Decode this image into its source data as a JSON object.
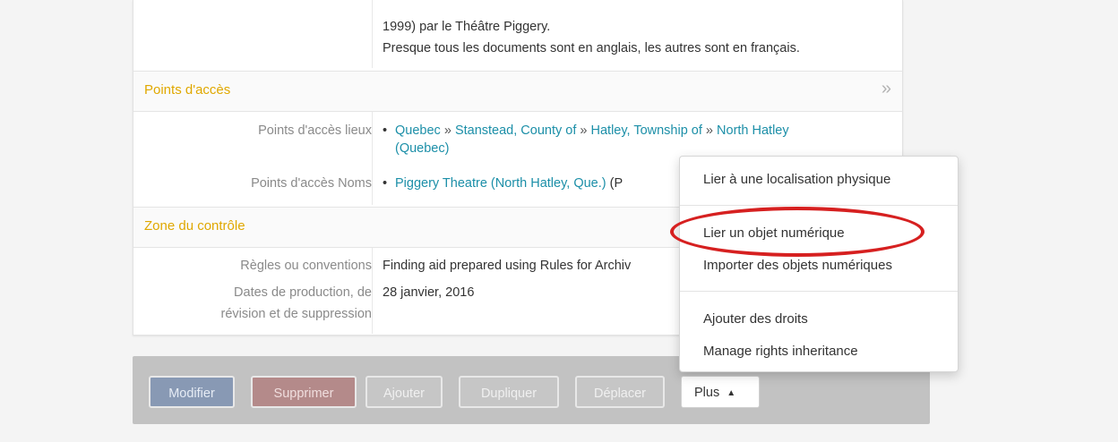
{
  "top": {
    "line1": "1999) par le Théâtre Piggery.",
    "line2": "Presque tous les documents sont en anglais, les autres sont en français."
  },
  "sections": {
    "access": {
      "title": "Points d'accès",
      "toggle": "»"
    },
    "control": {
      "title": "Zone du contrôle"
    }
  },
  "access_fields": {
    "places_label": "Points d'accès lieux",
    "places": [
      "Quebec",
      "Stanstead, County of",
      "Hatley, Township of",
      "North Hatley",
      "(Quebec)"
    ],
    "place_sep": "»",
    "names_label": "Points d'accès Noms",
    "name_link": "Piggery Theatre (North Hatley, Que.)",
    "name_suffix": "(P"
  },
  "control_fields": {
    "rules_label": "Règles ou conventions",
    "rules_value": "Finding aid prepared using Rules for Archiv",
    "dates_label_1": "Dates de production, de",
    "dates_label_2": "révision et de suppression",
    "dates_value": "28 janvier, 2016"
  },
  "actions": {
    "edit": "Modifier",
    "delete": "Supprimer",
    "add": "Ajouter",
    "duplicate": "Dupliquer",
    "move": "Déplacer",
    "more": "Plus",
    "more_icon": "caret-up-icon"
  },
  "menu": {
    "link_physical": "Lier à une localisation physique",
    "link_digital": "Lier un objet numérique",
    "import_digital": "Importer des objets numériques",
    "add_rights": "Ajouter des droits",
    "manage_rights": "Manage rights inheritance"
  },
  "colors": {
    "section_title": "#e0a800",
    "link": "#1c8fa8",
    "highlight_oval": "#d62020"
  }
}
